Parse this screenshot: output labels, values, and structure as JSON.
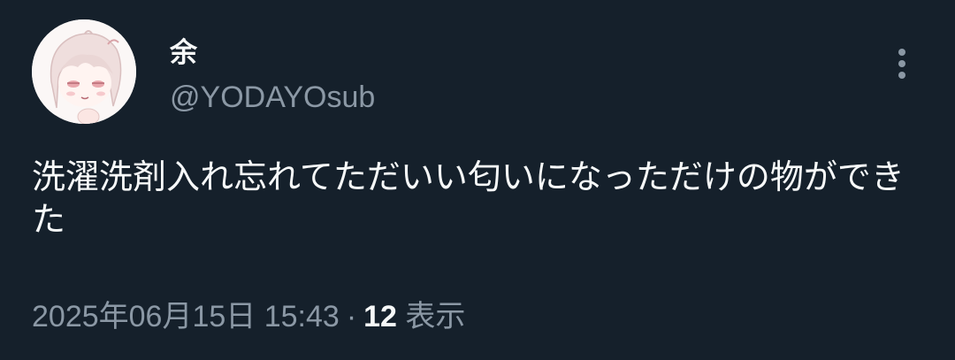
{
  "tweet": {
    "display_name": "余",
    "handle": "@YODAYOsub",
    "text": "洗濯洗剤入れ忘れてただいい匂いになっただけの物ができた",
    "timestamp": "2025年06月15日 15:43",
    "separator": "·",
    "views_count": "12",
    "views_label": "表示"
  },
  "icons": {
    "more": "more-vertical-icon",
    "avatar": "anime-character-avatar"
  },
  "colors": {
    "background": "#15202b",
    "primary_text": "#f7f9f9",
    "secondary_text": "#8b98a5"
  }
}
